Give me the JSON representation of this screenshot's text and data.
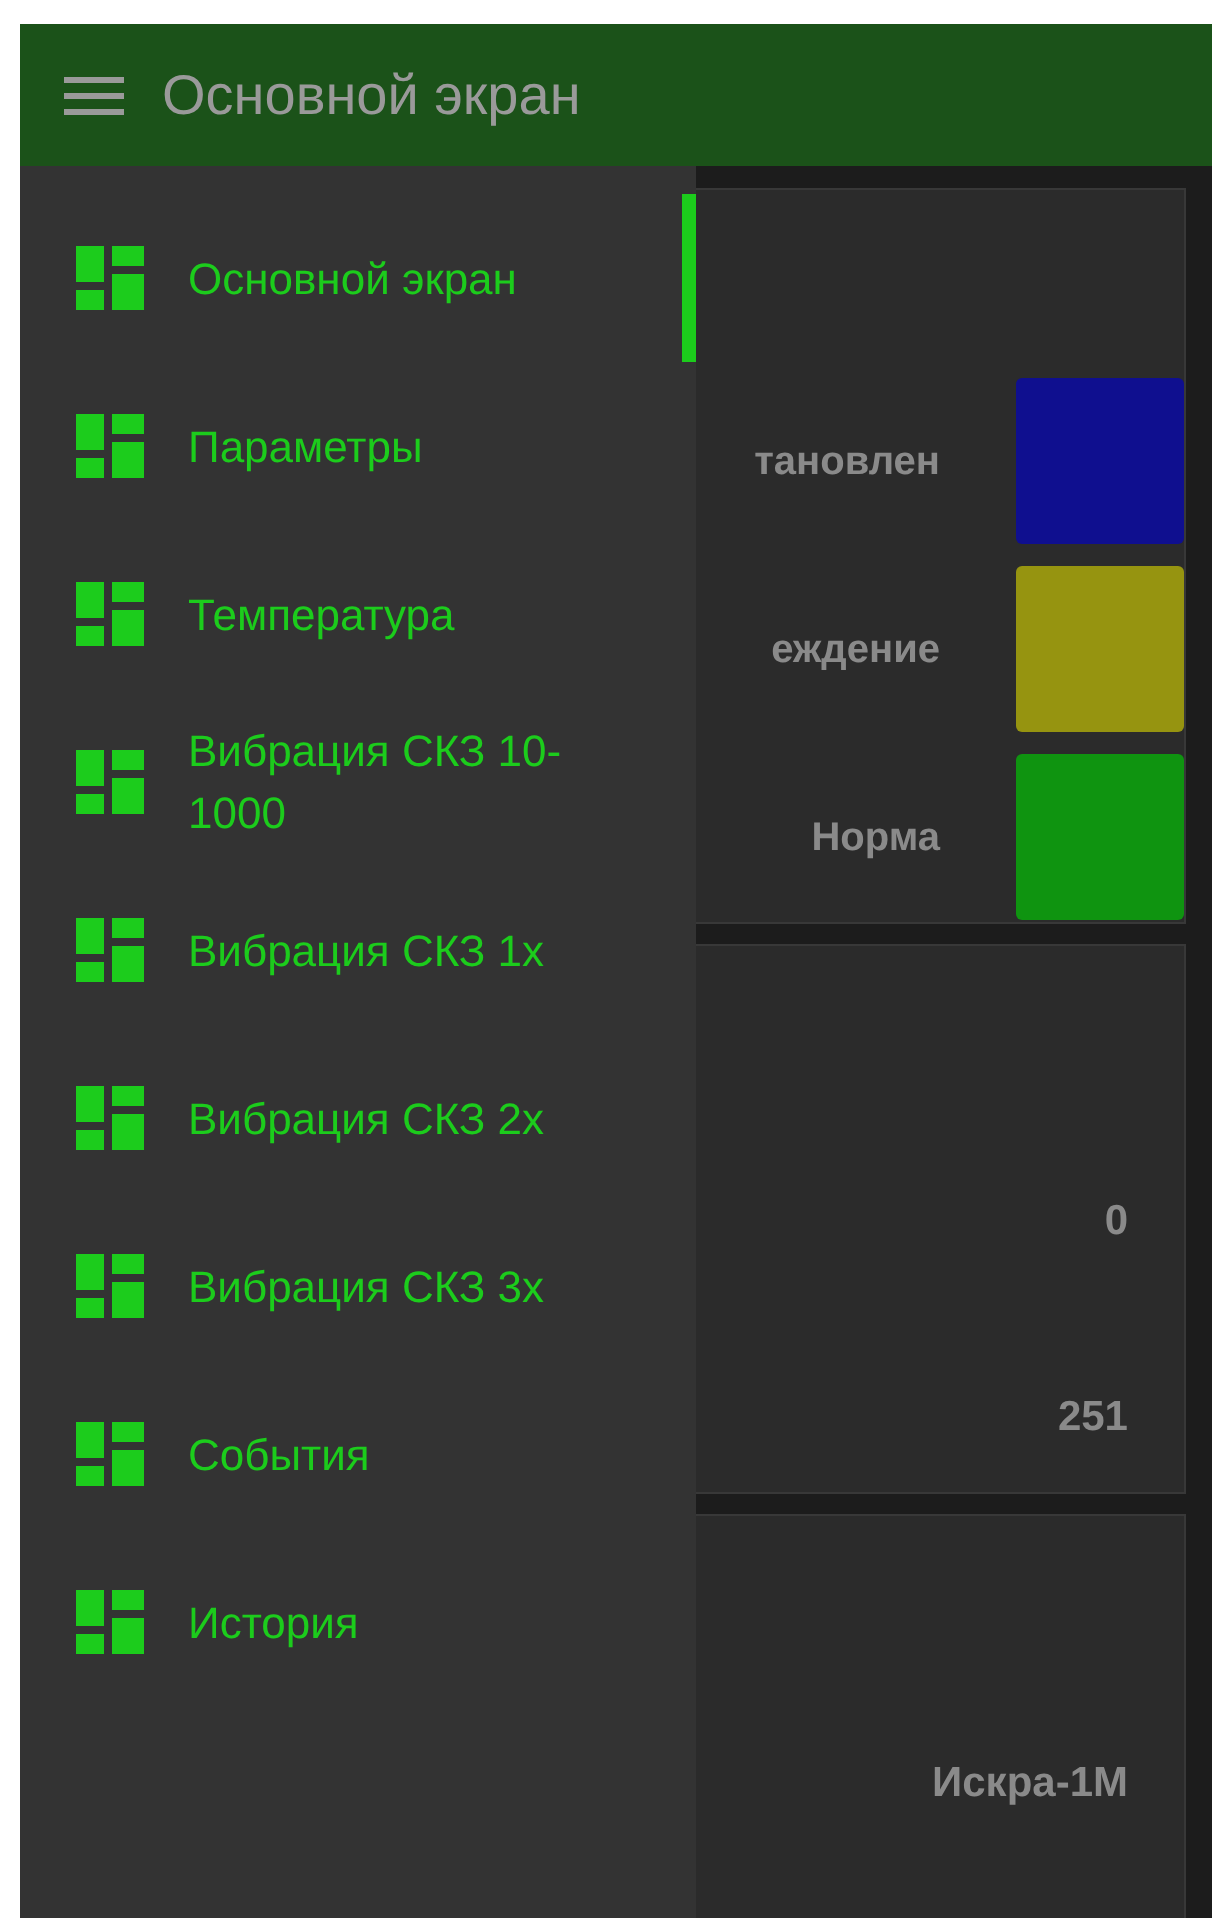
{
  "app_bar": {
    "title": "Основной экран"
  },
  "drawer": {
    "items": [
      {
        "label": "Основной экран",
        "selected": true
      },
      {
        "label": "Параметры",
        "selected": false
      },
      {
        "label": "Температура",
        "selected": false
      },
      {
        "label": "Вибрация СКЗ 10-1000",
        "selected": false
      },
      {
        "label": "Вибрация СКЗ 1x",
        "selected": false
      },
      {
        "label": "Вибрация СКЗ 2x",
        "selected": false
      },
      {
        "label": "Вибрация СКЗ 3x",
        "selected": false
      },
      {
        "label": "События",
        "selected": false
      },
      {
        "label": "История",
        "selected": false
      }
    ]
  },
  "status_card": {
    "rows": [
      {
        "label": "тановлен",
        "color": "#0f0f8f"
      },
      {
        "label": "еждение",
        "color": "#969410"
      },
      {
        "label": "Норма",
        "color": "#0f9410"
      }
    ]
  },
  "values_card": {
    "values": [
      "0",
      "251"
    ]
  },
  "device_card": {
    "name": "Искра-1М"
  }
}
